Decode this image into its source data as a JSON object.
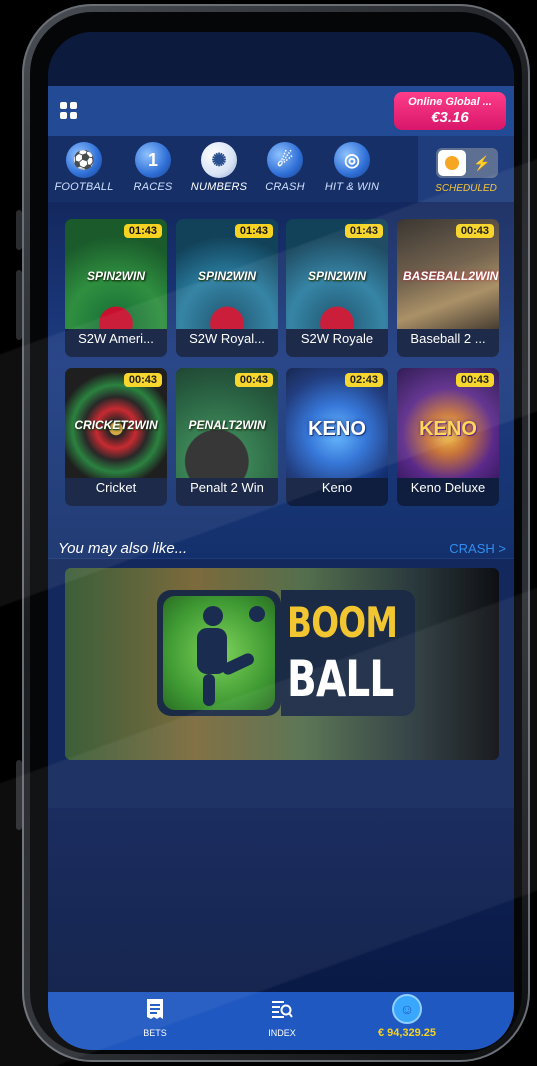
{
  "header": {
    "wallet_name": "Online Global ...",
    "wallet_amount": "€3.16"
  },
  "categories": [
    {
      "label": "FOOTBALL",
      "icon": "football-icon"
    },
    {
      "label": "RACES",
      "icon": "races-icon"
    },
    {
      "label": "NUMBERS",
      "icon": "numbers-icon",
      "selected": true
    },
    {
      "label": "CRASH",
      "icon": "crash-icon"
    },
    {
      "label": "HIT & WIN",
      "icon": "hit-and-win-icon"
    }
  ],
  "scheduled": {
    "label": "SCHEDULED"
  },
  "games": [
    {
      "name": "S2W Ameri...",
      "timer": "01:43",
      "logo": "SPIN2WIN"
    },
    {
      "name": "S2W Royal...",
      "timer": "01:43",
      "logo": "SPIN2WIN"
    },
    {
      "name": "S2W Royale",
      "timer": "01:43",
      "logo": "SPIN2WIN"
    },
    {
      "name": "Baseball 2 ...",
      "timer": "00:43",
      "logo": "BASEBALL2WIN"
    },
    {
      "name": "Cricket",
      "timer": "00:43",
      "logo": "CRICKET2WIN"
    },
    {
      "name": "Penalt 2 Win",
      "timer": "00:43",
      "logo": "PENALT2WIN"
    },
    {
      "name": "Keno",
      "timer": "02:43",
      "logo": "KENO"
    },
    {
      "name": "Keno Deluxe",
      "timer": "00:43",
      "logo": "KENO"
    }
  ],
  "recommendation": {
    "title": "You may also like...",
    "link": "CRASH >",
    "banner_line1": "BOOM",
    "banner_line2": "BALL"
  },
  "nav": {
    "bets": "BETS",
    "index": "INDEX",
    "balance": "€ 94,329.25"
  },
  "colors": {
    "accent_pink": "#e8237a",
    "timer_yellow": "#f7d321",
    "nav_blue": "#1f58c0"
  }
}
